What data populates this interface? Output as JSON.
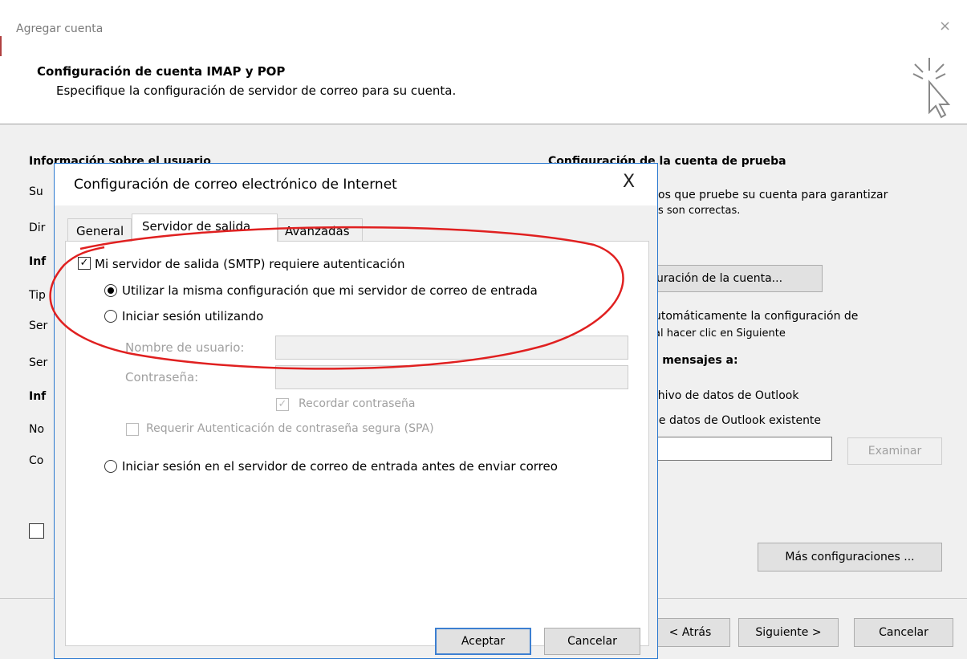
{
  "window": {
    "title": "Agregar cuenta",
    "close_glyph": "×"
  },
  "header": {
    "title": "Configuración de cuenta IMAP y POP",
    "subtitle": "Especifique la configuración de servidor de correo para su cuenta."
  },
  "left_panel": {
    "user_info_heading": "Información sobre el usuario",
    "row_labels": [
      "Su",
      "Dir",
      "Inf",
      "Tip",
      "Ser",
      "Ser",
      "Inf",
      "No",
      "Co"
    ]
  },
  "right_panel": {
    "test_heading": "Configuración de la cuenta de prueba",
    "test_text_line1": "os que pruebe su cuenta para garantizar",
    "test_text_line2": "s son correctas.",
    "test_button_label": "uración de la cuenta...",
    "auto_test_line1": "utomáticamente la configuración de",
    "auto_test_line2": "al hacer clic en Siguiente",
    "deliver_heading": "s mensajes a:",
    "option_new": "chivo de datos de Outlook",
    "option_existing": "de datos de Outlook existente",
    "browse_label": "Examinar",
    "more_settings_label": "Más configuraciones ..."
  },
  "footer": {
    "back_label": "< Atrás",
    "next_label": "Siguiente >",
    "cancel_label": "Cancelar"
  },
  "dialog": {
    "title": "Configuración de correo electrónico de Internet",
    "close_glyph": "X",
    "tabs": [
      {
        "label": "General",
        "active": false
      },
      {
        "label": "Servidor de salida",
        "active": true
      },
      {
        "label": "Avanzadas",
        "active": false
      }
    ],
    "smtp_auth_label": "Mi servidor de salida (SMTP) requiere autenticación",
    "smtp_auth_checked": true,
    "same_settings_label": "Utilizar la misma configuración que mi servidor de correo de entrada",
    "login_using_label": "Iniciar sesión utilizando",
    "username_label": "Nombre de usuario:",
    "username_value": "",
    "password_label": "Contraseña:",
    "password_value": "",
    "remember_password_label": "Recordar contraseña",
    "remember_password_checked": true,
    "spa_label": "Requerir Autenticación de contraseña segura (SPA)",
    "spa_checked": false,
    "login_incoming_first_label": "Iniciar sesión en el servidor de correo de entrada antes de enviar correo",
    "ok_label": "Aceptar",
    "cancel_label": "Cancelar"
  },
  "colors": {
    "dialog_border": "#2b79d0",
    "annotation_red": "#e02020",
    "window_bg": "#f0f0f0"
  }
}
